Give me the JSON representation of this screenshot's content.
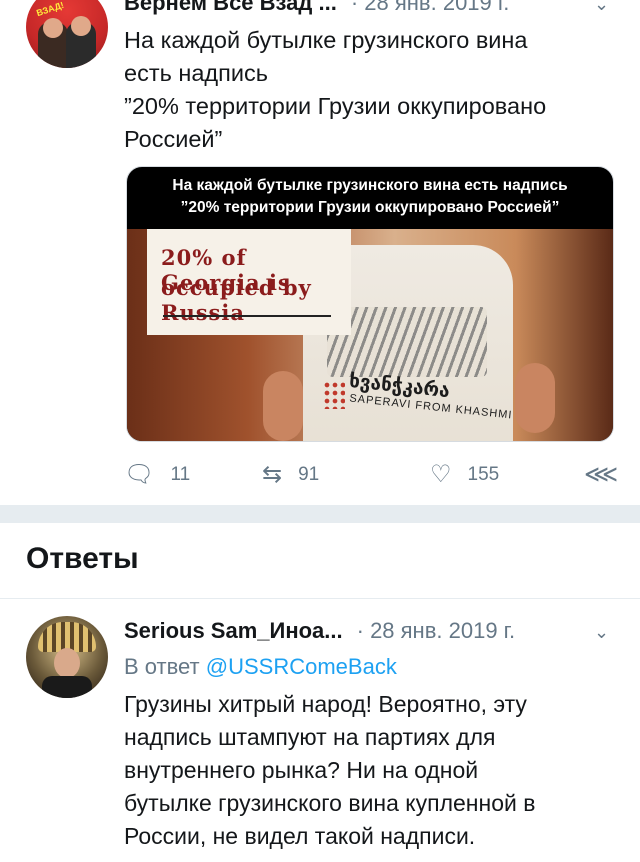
{
  "tweet": {
    "author_name": "Вернем Все Взад ...",
    "date": "· 28 янв. 2019 г.",
    "text_lines": [
      "На каждой бутылке грузинского вина",
      "есть надпись",
      "”20% территории Грузии оккупировано",
      "Россией”"
    ],
    "media": {
      "caption_line1": "На каждой бутылке грузинского вина есть надпись",
      "caption_line2": "”20% территории Грузии оккупировано Россией”",
      "label_line1": "20% of Georgia is",
      "label_line2": "occupied by Russia",
      "wine_georgian": "ხვანჭკარა",
      "wine_name": "SAPERAVI FROM KHASHMI"
    },
    "actions": {
      "reply_count": "11",
      "retweet_count": "91",
      "like_count": "155"
    },
    "icons": {
      "reply": "reply-icon",
      "retweet": "retweet-icon",
      "like": "heart-icon",
      "share": "share-icon",
      "menu": "chevron-down-icon"
    }
  },
  "replies_section": {
    "title": "Ответы"
  },
  "reply": {
    "author_name": "Serious Sam_Иноа...",
    "date": "· 28 янв. 2019 г.",
    "in_reply_prefix": "В ответ",
    "in_reply_mention": "@USSRComeBack",
    "text_lines": [
      "Грузины хитрый народ! Вероятно, эту",
      "надпись штампуют на партиях для",
      "внутреннего рынка? Ни на одной",
      "бутылке грузинского вина купленной в",
      "России, не видел такой надписи."
    ]
  },
  "colors": {
    "text": "#14171a",
    "secondary": "#657786",
    "link": "#1da1f2",
    "separator": "#e6ecf0"
  }
}
